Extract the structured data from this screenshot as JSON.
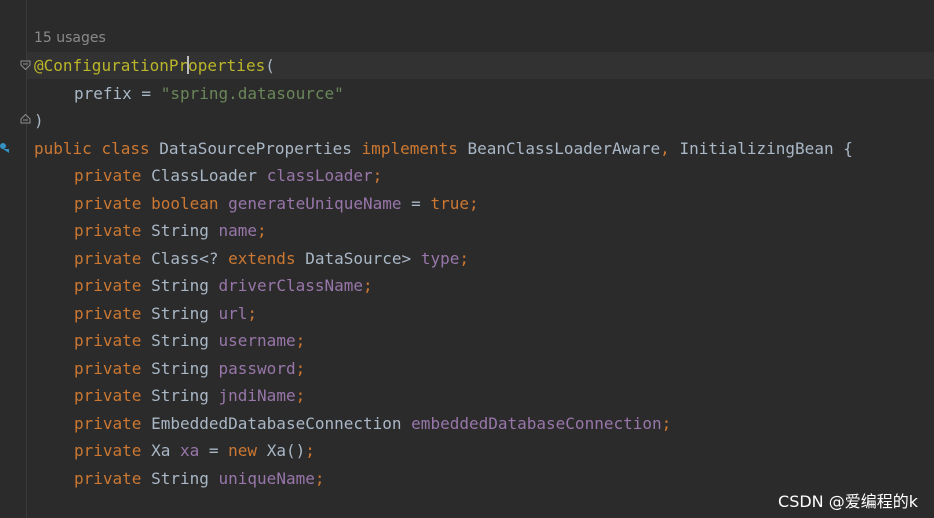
{
  "inlay": {
    "usages": "15 usages"
  },
  "code": {
    "annotation_at": "@",
    "annotation_name_a": "ConfigurationPr",
    "annotation_name_b": "operties",
    "open_paren": "(",
    "prefix_key": "prefix",
    "equals": " = ",
    "prefix_value": "\"spring.datasource\"",
    "close_paren": ")",
    "class_decl": {
      "kw_public": "public",
      "kw_class": "class",
      "class_name": "DataSourceProperties",
      "kw_implements": "implements",
      "iface1": "BeanClassLoaderAware",
      "comma": ",",
      "iface2": "InitializingBean",
      "brace": "{"
    },
    "kw_private": "private",
    "fields": [
      {
        "type": "ClassLoader",
        "name": "classLoader"
      },
      {
        "type": "boolean",
        "name": "generateUniqueName",
        "init": "true"
      },
      {
        "type": "String",
        "name": "name"
      },
      {
        "type_a": "Class<? ",
        "type_kw": "extends",
        "type_b": " DataSource>",
        "name": "type"
      },
      {
        "type": "String",
        "name": "driverClassName"
      },
      {
        "type": "String",
        "name": "url"
      },
      {
        "type": "String",
        "name": "username"
      },
      {
        "type": "String",
        "name": "password"
      },
      {
        "type": "String",
        "name": "jndiName"
      },
      {
        "type": "EmbeddedDatabaseConnection",
        "name": "embeddedDatabaseConnection"
      },
      {
        "type": "Xa",
        "name": "xa",
        "init_kw": "new",
        "init_expr": "Xa()"
      },
      {
        "type": "String",
        "name": "uniqueName"
      }
    ],
    "semicolon": ";"
  },
  "watermark": {
    "text": "CSDN @爱编程的k"
  },
  "colors": {
    "background": "#2b2b2b",
    "keyword": "#cc7832",
    "field": "#9876aa",
    "string": "#6a8759",
    "annotation": "#bbb529",
    "default_text": "#a9b7c6"
  }
}
